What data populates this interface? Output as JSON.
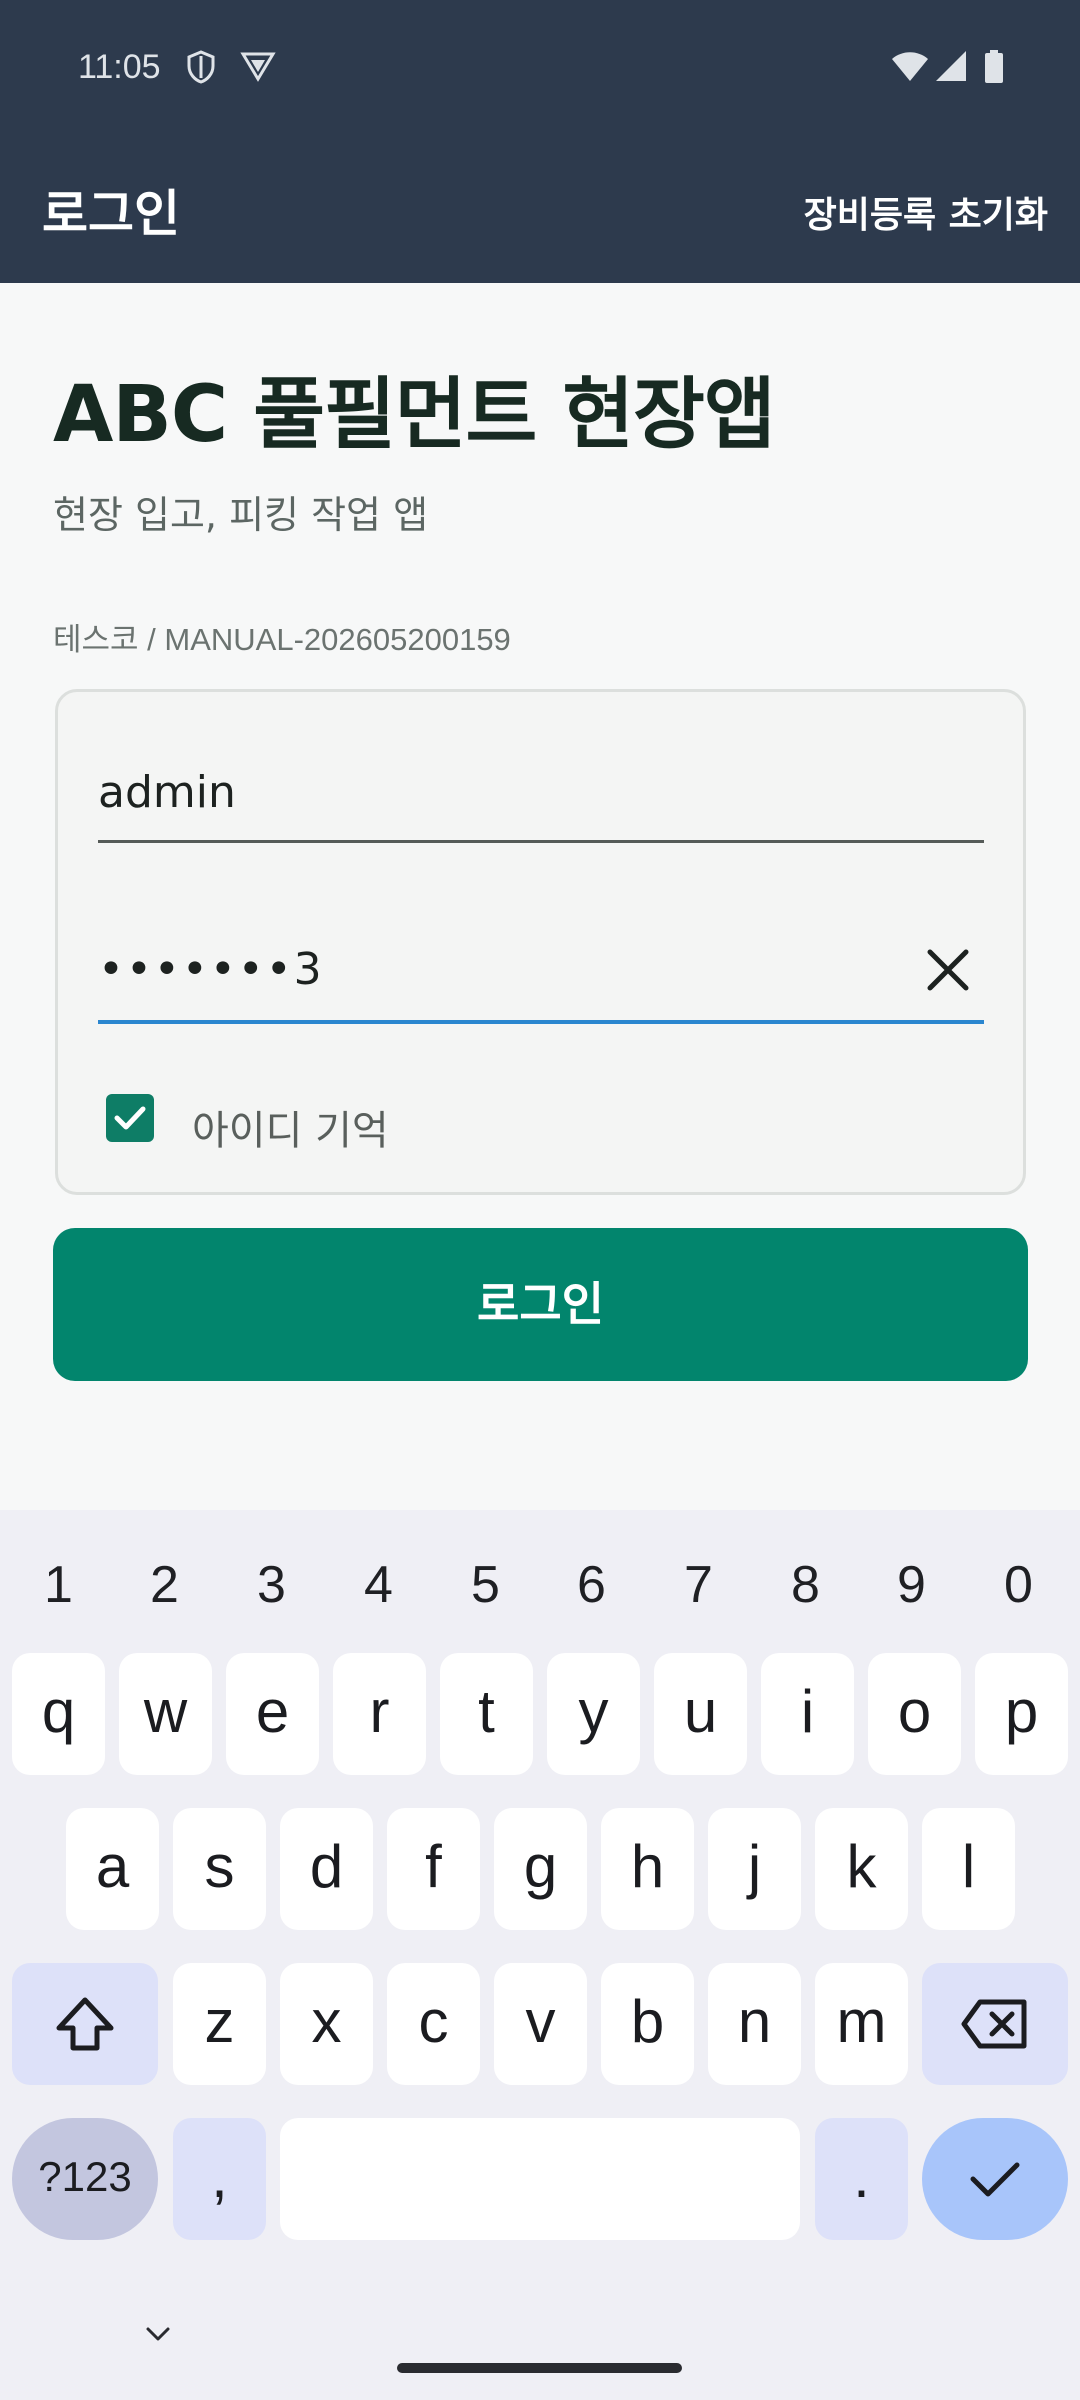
{
  "status_bar": {
    "time": "11:05",
    "icons": [
      "shield-icon",
      "vpn-icon",
      "wifi-icon",
      "signal-icon",
      "battery-icon"
    ]
  },
  "app_bar": {
    "title": "로그인",
    "action_label": "장비등록 초기화"
  },
  "main": {
    "headline": "ABC 풀필먼트 현장앱",
    "subtitle": "현장 입고, 피킹 작업 앱",
    "device_info": "테스코 / MANUAL-202605200159"
  },
  "login_form": {
    "username_value": "admin",
    "password_value": "•••••••3",
    "clear_icon": "close-icon",
    "remember_label": "아이디 기억",
    "remember_checked": true,
    "submit_label": "로그인"
  },
  "keyboard": {
    "numbers": [
      "1",
      "2",
      "3",
      "4",
      "5",
      "6",
      "7",
      "8",
      "9",
      "0"
    ],
    "row1": [
      "q",
      "w",
      "e",
      "r",
      "t",
      "y",
      "u",
      "i",
      "o",
      "p"
    ],
    "row2": [
      "a",
      "s",
      "d",
      "f",
      "g",
      "h",
      "j",
      "k",
      "l"
    ],
    "row3": [
      "z",
      "x",
      "c",
      "v",
      "b",
      "n",
      "m"
    ],
    "symbols_label": "?123",
    "comma_label": ",",
    "period_label": ".",
    "accent_color": "#a8c5fa"
  },
  "colors": {
    "app_bar": "#2d3a4d",
    "primary": "#02856d",
    "focus_underline": "#2a86cf"
  }
}
